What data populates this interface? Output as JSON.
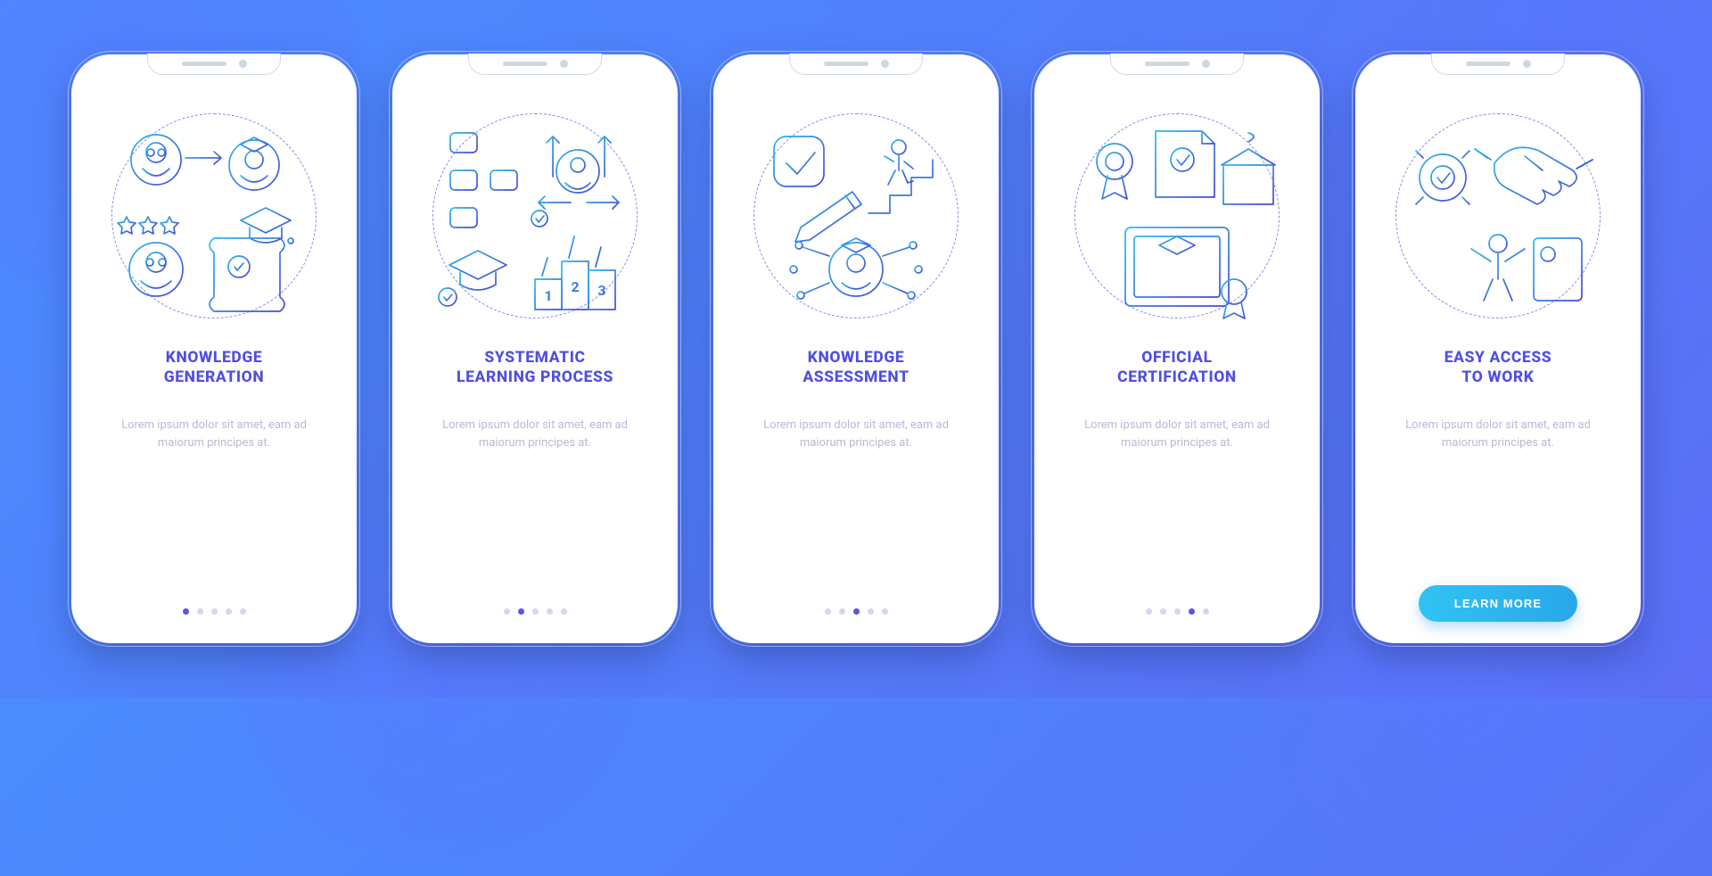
{
  "colors": {
    "background_start": "#4a8cff",
    "background_end": "#5b6ef5",
    "title": "#4f4fe0",
    "desc": "#b6bbd6",
    "dot_inactive": "#d3d8ea",
    "dot_active": "#5a54e8",
    "cta_start": "#31c3f3",
    "cta_end": "#2aa7ea",
    "stroke_start": "#2fb9e8",
    "stroke_end": "#4747d8"
  },
  "cta_label": "LEARN MORE",
  "placeholder_desc": "Lorem ipsum dolor sit amet, eam ad maiorum principes at.",
  "screens": [
    {
      "title_line1": "KNOWLEDGE",
      "title_line2": "GENERATION",
      "desc": "Lorem ipsum dolor sit amet, eam ad maiorum principes at.",
      "icon": "knowledge-generation-illustration",
      "active_dot": 0,
      "has_cta": false
    },
    {
      "title_line1": "SYSTEMATIC",
      "title_line2": "LEARNING PROCESS",
      "desc": "Lorem ipsum dolor sit amet, eam ad maiorum principes at.",
      "icon": "systematic-learning-illustration",
      "active_dot": 1,
      "has_cta": false
    },
    {
      "title_line1": "KNOWLEDGE",
      "title_line2": "ASSESSMENT",
      "desc": "Lorem ipsum dolor sit amet, eam ad maiorum principes at.",
      "icon": "knowledge-assessment-illustration",
      "active_dot": 2,
      "has_cta": false
    },
    {
      "title_line1": "OFFICIAL",
      "title_line2": "CERTIFICATION",
      "desc": "Lorem ipsum dolor sit amet, eam ad maiorum principes at.",
      "icon": "official-certification-illustration",
      "active_dot": 3,
      "has_cta": false
    },
    {
      "title_line1": "EASY ACCESS",
      "title_line2": "TO WORK",
      "desc": "Lorem ipsum dolor sit amet, eam ad maiorum principes at.",
      "icon": "easy-access-work-illustration",
      "active_dot": 4,
      "has_cta": true
    }
  ]
}
